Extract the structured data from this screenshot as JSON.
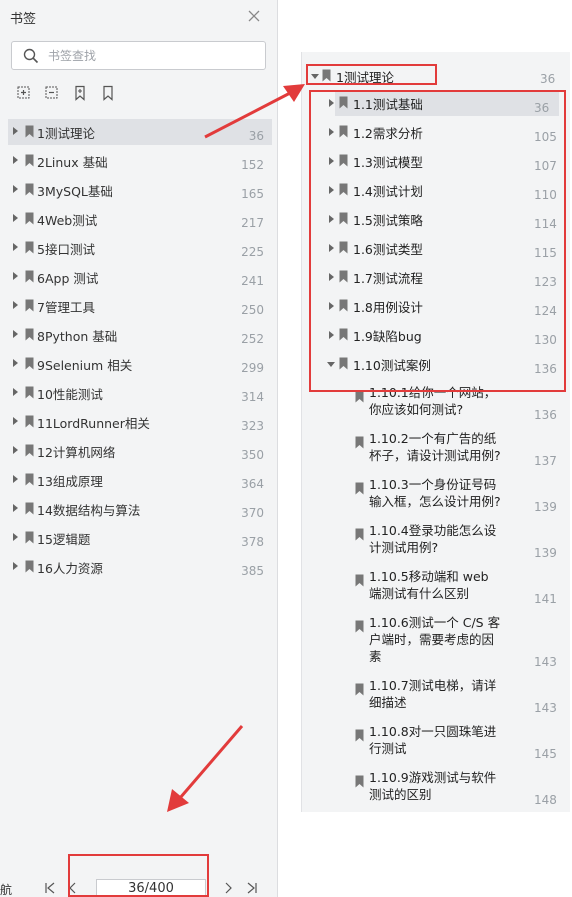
{
  "panel": {
    "title": "书签",
    "search_placeholder": "书签查找"
  },
  "bookmarks": [
    {
      "label": "1测试理论",
      "page": "36",
      "selected": true
    },
    {
      "label": "2Linux 基础",
      "page": "152"
    },
    {
      "label": "3MySQL基础",
      "page": "165"
    },
    {
      "label": "4Web测试",
      "page": "217"
    },
    {
      "label": "5接口测试",
      "page": "225"
    },
    {
      "label": "6App 测试",
      "page": "241"
    },
    {
      "label": "7管理工具",
      "page": "250"
    },
    {
      "label": "8Python 基础",
      "page": "252"
    },
    {
      "label": "9Selenium 相关",
      "page": "299"
    },
    {
      "label": "10性能测试",
      "page": "314"
    },
    {
      "label": "11LordRunner相关",
      "page": "323"
    },
    {
      "label": "12计算机网络",
      "page": "350"
    },
    {
      "label": "13组成原理",
      "page": "364"
    },
    {
      "label": "14数据结构与算法",
      "page": "370"
    },
    {
      "label": "15逻辑题",
      "page": "378"
    },
    {
      "label": "16人力资源",
      "page": "385"
    }
  ],
  "bottom_bar": {
    "nav_label": "航",
    "page_indicator": "36/400"
  },
  "expanded": {
    "root": {
      "label": "1测试理论",
      "page": "36"
    },
    "children": [
      {
        "label": "1.1测试基础",
        "page": "36",
        "selected": true
      },
      {
        "label": "1.2需求分析",
        "page": "105"
      },
      {
        "label": "1.3测试模型",
        "page": "107"
      },
      {
        "label": "1.4测试计划",
        "page": "110"
      },
      {
        "label": "1.5测试策略",
        "page": "114"
      },
      {
        "label": "1.6测试类型",
        "page": "115"
      },
      {
        "label": "1.7测试流程",
        "page": "123"
      },
      {
        "label": "1.8用例设计",
        "page": "124"
      },
      {
        "label": "1.9缺陷bug",
        "page": "130"
      },
      {
        "label": "1.10测试案例",
        "page": "136",
        "expanded": true
      }
    ],
    "grandchildren": [
      {
        "label": "1.10.1给你一个网站，你应该如何测试?",
        "page": "136"
      },
      {
        "label": "1.10.2一个有广告的纸杯子，请设计测试用例?",
        "page": "137"
      },
      {
        "label": "1.10.3一个身份证号码输入框，怎么设计用例?",
        "page": "139"
      },
      {
        "label": "1.10.4登录功能怎么设计测试用例?",
        "page": "139"
      },
      {
        "label": "1.10.5移动端和 web 端测试有什么区别",
        "page": "141"
      },
      {
        "label": "1.10.6测试一个 C/S 客户端时，需要考虑的因素",
        "page": "143"
      },
      {
        "label": "1.10.7测试电梯，请详细描述",
        "page": "143"
      },
      {
        "label": "1.10.8对一只圆珠笔进行测试",
        "page": "145"
      },
      {
        "label": "1.10.9游戏测试与软件测试的区别",
        "page": "148"
      }
    ]
  },
  "colors": {
    "panel_bg": "#f3f4f5",
    "selected_bg": "#dfe1e5",
    "annotation_red": "#e23b3b",
    "page_number": "#9aa0a6"
  }
}
